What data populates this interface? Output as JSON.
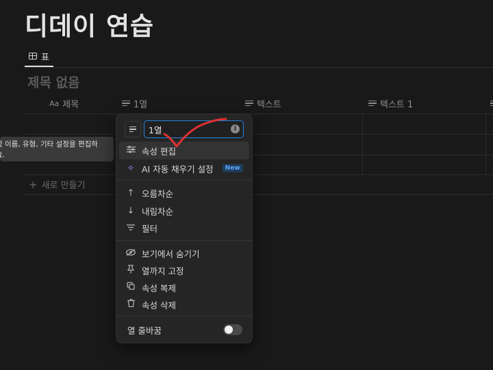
{
  "page_title": "디데이 연습",
  "view_tab": {
    "label": "표"
  },
  "database": {
    "title": "제목 없음"
  },
  "columns": [
    {
      "label": "제목",
      "icon": "Aa"
    },
    {
      "label": "1열",
      "icon": "text-lines-icon"
    },
    {
      "label": "텍스트",
      "icon": "text-lines-icon"
    },
    {
      "label": "텍스트 1",
      "icon": "text-lines-icon"
    }
  ],
  "new_row_label": "새로 만들기",
  "tooltip": {
    "line1": "성 이름, 유형, 기타 설정을 편집하",
    "line2": "요."
  },
  "property_menu": {
    "name_value": "1열",
    "items": [
      {
        "label": "속성 편집",
        "icon": "sliders-icon"
      },
      {
        "label": "AI 자동 채우기 설정",
        "icon": "ai-sparkle-icon",
        "badge": "New"
      },
      {
        "label": "오름차순",
        "icon": "arrow-up-icon"
      },
      {
        "label": "내림차순",
        "icon": "arrow-down-icon"
      },
      {
        "label": "필터",
        "icon": "filter-icon"
      },
      {
        "label": "보기에서 숨기기",
        "icon": "eye-hidden-icon"
      },
      {
        "label": "열까지 고정",
        "icon": "pin-icon"
      },
      {
        "label": "속성 복제",
        "icon": "duplicate-icon"
      },
      {
        "label": "속성 삭제",
        "icon": "trash-icon"
      }
    ],
    "wrap_label": "열 줄바꿈",
    "wrap_enabled": false
  },
  "colors": {
    "background": "#191919",
    "menu": "#252525",
    "accent": "#2383e2",
    "annotation": "#e03131"
  }
}
